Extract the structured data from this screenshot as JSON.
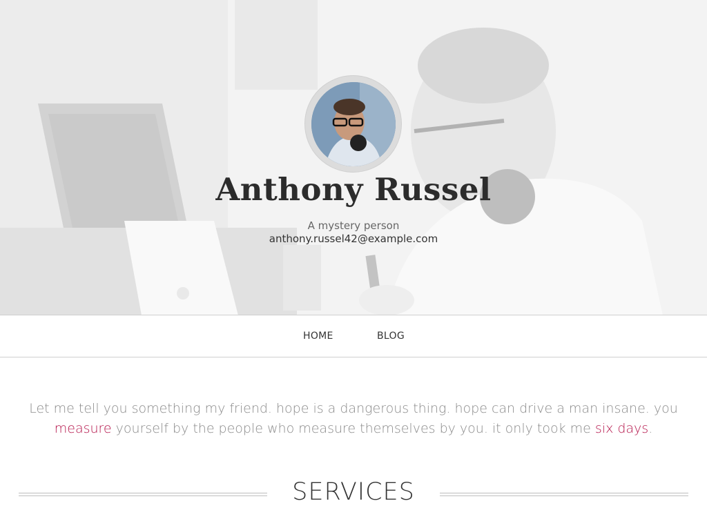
{
  "hero": {
    "name": "Anthony Russel",
    "tagline": "A mystery person",
    "email": "anthony.russel42@example.com"
  },
  "nav": {
    "items": [
      {
        "label": "HOME"
      },
      {
        "label": "BLOG"
      }
    ]
  },
  "intro": {
    "text_1": "Let me tell you something my friend. hope is a dangerous thing. hope can drive a man insane. you ",
    "link_1": "measure",
    "text_2": " yourself by the people who measure themselves by you. it only took me ",
    "link_2": "six days",
    "text_3": "."
  },
  "services": {
    "title": "SERVICES"
  },
  "colors": {
    "accent": "#b5154b",
    "nav_border": "#cfcfcf",
    "body_text": "#8a8a8a"
  }
}
